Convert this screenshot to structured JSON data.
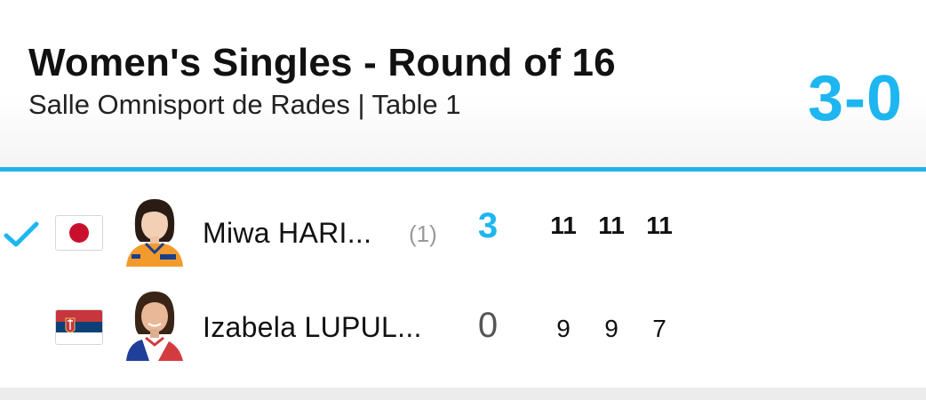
{
  "match": {
    "title": "Women's Singles - Round of 16",
    "venue": "Salle Omnisport de Rades | Table 1",
    "score": "3-0"
  },
  "players": [
    {
      "name": "Miwa HARI...",
      "seed": "(1)",
      "games": "3",
      "sets": [
        "11",
        "11",
        "11"
      ],
      "winner": true,
      "flag_icon": "japan-flag-icon"
    },
    {
      "name": "Izabela LUPUL...",
      "seed": "",
      "games": "0",
      "sets": [
        "9",
        "9",
        "7"
      ],
      "winner": false,
      "flag_icon": "serbia-flag-icon"
    }
  ],
  "colors": {
    "accent": "#1eb6f0",
    "divider": "#22b2ec"
  }
}
